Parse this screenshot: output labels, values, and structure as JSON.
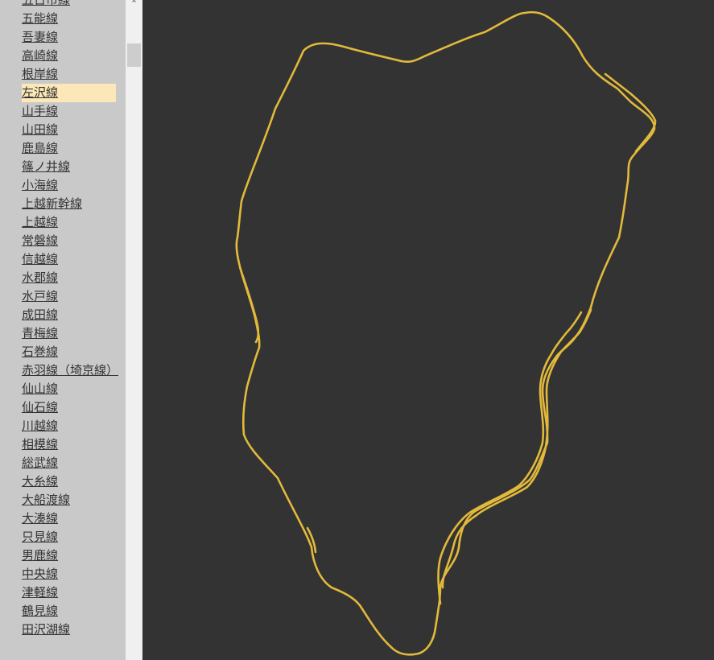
{
  "sidebar": {
    "selected_index": 5,
    "items": [
      {
        "label": "五日市線"
      },
      {
        "label": "五能線"
      },
      {
        "label": "吾妻線"
      },
      {
        "label": "高崎線"
      },
      {
        "label": "根岸線"
      },
      {
        "label": "左沢線"
      },
      {
        "label": "山手線"
      },
      {
        "label": "山田線"
      },
      {
        "label": "鹿島線"
      },
      {
        "label": "篠ノ井線"
      },
      {
        "label": "小海線"
      },
      {
        "label": "上越新幹線"
      },
      {
        "label": "上越線"
      },
      {
        "label": "常磐線"
      },
      {
        "label": "信越線"
      },
      {
        "label": "水郡線"
      },
      {
        "label": "水戸線"
      },
      {
        "label": "成田線"
      },
      {
        "label": "青梅線"
      },
      {
        "label": "石巻線"
      },
      {
        "label": "赤羽線（埼京線）"
      },
      {
        "label": "仙山線"
      },
      {
        "label": "仙石線"
      },
      {
        "label": "川越線"
      },
      {
        "label": "相模線"
      },
      {
        "label": "総武線"
      },
      {
        "label": "大糸線"
      },
      {
        "label": "大船渡線"
      },
      {
        "label": "大湊線"
      },
      {
        "label": "只見線"
      },
      {
        "label": "男鹿線"
      },
      {
        "label": "中央線"
      },
      {
        "label": "津軽線"
      },
      {
        "label": "鶴見線"
      },
      {
        "label": "田沢湖線"
      }
    ]
  },
  "scrollbar": {
    "up_arrow_icon": "chevron-up-icon"
  },
  "map": {
    "route_color": "#e2b93b",
    "background_color": "#333333"
  }
}
